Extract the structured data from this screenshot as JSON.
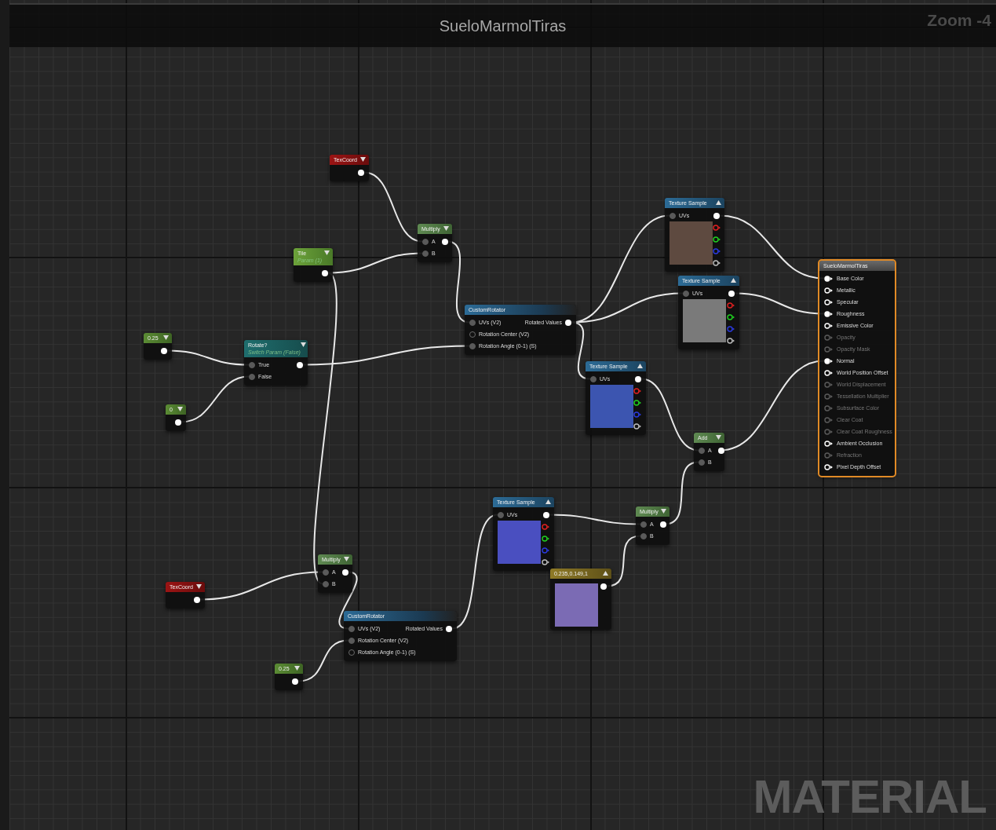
{
  "graph_title": "SueloMarmolTiras",
  "zoom_label": "Zoom -4",
  "watermark": "MATERIAL",
  "nodes": [
    {
      "kind": "texcoord",
      "title": "TexCoord"
    },
    {
      "kind": "texture",
      "title": "Texture Sample",
      "color": "#5e4a40",
      "inputs": [
        {
          "label": "UVs",
          "connected": true
        }
      ]
    },
    {
      "kind": "multiply",
      "title": "Multiply",
      "inputs": [
        {
          "label": "A",
          "connected": true
        },
        {
          "label": "B",
          "connected": true
        }
      ]
    },
    {
      "kind": "param",
      "title": "Tile",
      "subtitle": "Param (1)"
    },
    {
      "kind": "material",
      "title": "SueloMarmolTiras",
      "inputs": [
        {
          "label": "Base Color",
          "connected": true,
          "disabled": false
        },
        {
          "label": "Metallic",
          "connected": false,
          "disabled": false
        },
        {
          "label": "Specular",
          "connected": false,
          "disabled": false
        },
        {
          "label": "Roughness",
          "connected": true,
          "disabled": false
        },
        {
          "label": "Emissive Color",
          "connected": false,
          "disabled": false
        },
        {
          "label": "Opacity",
          "connected": false,
          "disabled": true
        },
        {
          "label": "Opacity Mask",
          "connected": false,
          "disabled": true
        },
        {
          "label": "Normal",
          "connected": true,
          "disabled": false
        },
        {
          "label": "World Position Offset",
          "connected": false,
          "disabled": false
        },
        {
          "label": "World Displacement",
          "connected": false,
          "disabled": true
        },
        {
          "label": "Tessellation Multiplier",
          "connected": false,
          "disabled": true
        },
        {
          "label": "Subsurface Color",
          "connected": false,
          "disabled": true
        },
        {
          "label": "Clear Coat",
          "connected": false,
          "disabled": true
        },
        {
          "label": "Clear Coat Roughness",
          "connected": false,
          "disabled": true
        },
        {
          "label": "Ambient Occlusion",
          "connected": false,
          "disabled": false
        },
        {
          "label": "Refraction",
          "connected": false,
          "disabled": true
        },
        {
          "label": "Pixel Depth Offset",
          "connected": false,
          "disabled": false
        }
      ]
    },
    {
      "kind": "texture",
      "title": "Texture Sample",
      "color": "#7a7a7a",
      "inputs": [
        {
          "label": "UVs",
          "connected": true
        }
      ]
    },
    {
      "kind": "custom",
      "title": "CustomRotator",
      "output": "Rotated Values",
      "inputs": [
        {
          "label": "UVs (V2)",
          "connected": true
        },
        {
          "label": "Rotation Center (V2)",
          "connected": false
        },
        {
          "label": "Rotation Angle (0-1) (S)",
          "connected": true
        }
      ]
    },
    {
      "kind": "constant",
      "title": "0.25"
    },
    {
      "kind": "switch",
      "title": "Rotate?",
      "subtitle": "Switch Param (False)",
      "inputs": [
        {
          "label": "True",
          "connected": true
        },
        {
          "label": "False",
          "connected": true
        }
      ]
    },
    {
      "kind": "texture",
      "title": "Texture Sample",
      "color": "#3c55b0",
      "inputs": [
        {
          "label": "UVs",
          "connected": true
        }
      ]
    },
    {
      "kind": "constant",
      "title": "0"
    },
    {
      "kind": "add",
      "title": "Add",
      "inputs": [
        {
          "label": "A",
          "connected": true
        },
        {
          "label": "B",
          "connected": true
        }
      ]
    },
    {
      "kind": "texture",
      "title": "Texture Sample",
      "color": "#4a4fc0",
      "inputs": [
        {
          "label": "UVs",
          "connected": true
        }
      ]
    },
    {
      "kind": "multiply",
      "title": "Multiply",
      "inputs": [
        {
          "label": "A",
          "connected": true
        },
        {
          "label": "B",
          "connected": true
        }
      ]
    },
    {
      "kind": "multiply",
      "title": "Multiply",
      "inputs": [
        {
          "label": "A",
          "connected": true
        },
        {
          "label": "B",
          "connected": true
        }
      ]
    },
    {
      "kind": "vector",
      "title": "0.235,0.149,1",
      "color": "#7b6bb4"
    },
    {
      "kind": "texcoord",
      "title": "TexCoord"
    },
    {
      "kind": "custom",
      "title": "CustomRotator",
      "output": "Rotated Values",
      "inputs": [
        {
          "label": "UVs (V2)",
          "connected": true
        },
        {
          "label": "Rotation Center (V2)",
          "connected": true
        },
        {
          "label": "Rotation Angle (0-1) (S)",
          "connected": false
        }
      ]
    },
    {
      "kind": "constant",
      "title": "0.25"
    }
  ]
}
